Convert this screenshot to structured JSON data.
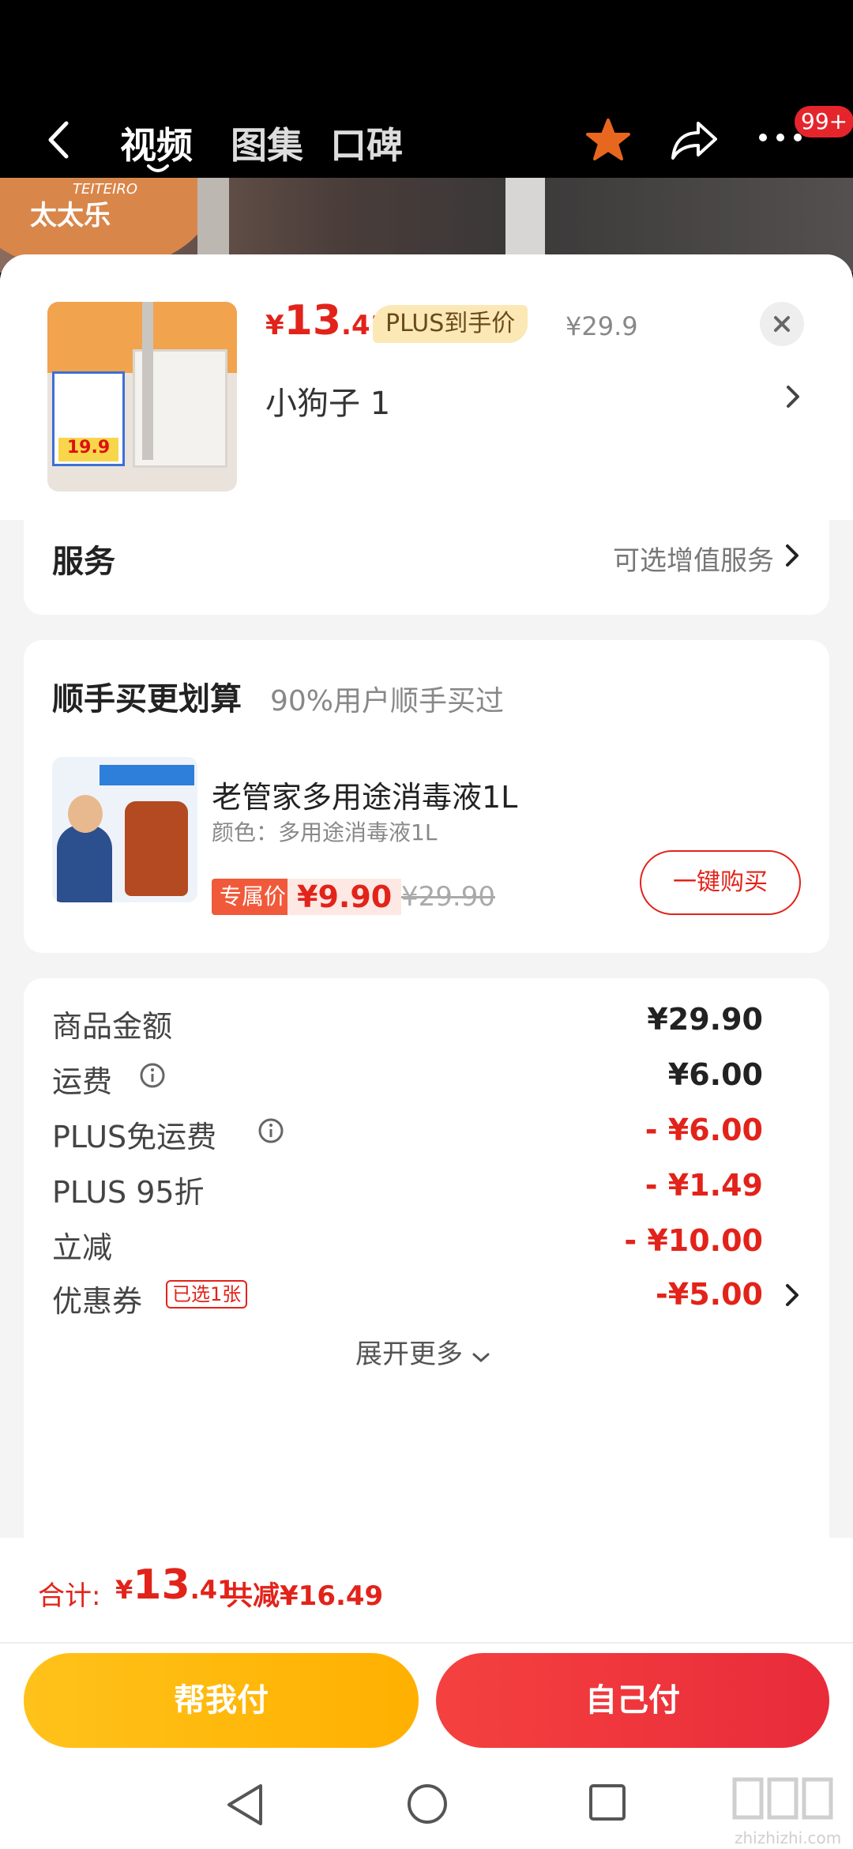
{
  "header": {
    "tabs": [
      {
        "label": "视频",
        "active": true
      },
      {
        "label": "图集",
        "active": false
      },
      {
        "label": "口碑",
        "active": false
      }
    ],
    "badge": "99+",
    "bg_brand": "TEITEIRO",
    "bg_brand_cn": "太太乐"
  },
  "product": {
    "price_currency": "¥",
    "price_int": "13",
    "price_dec": ".41",
    "plus_tag": "PLUS到手价",
    "orig_price": "¥29.9",
    "spec": "小狗子  1",
    "thumb_price": "19.9"
  },
  "service": {
    "title": "服务",
    "right": "可选增值服务"
  },
  "addon": {
    "title": "顺手买更划算",
    "subtitle": "90%用户顺手买过",
    "name": "老管家多用途消毒液1L",
    "color": "颜色：多用途消毒液1L",
    "exclusive_label": "专属价",
    "exclusive_price": "¥9.90",
    "orig_price": "¥29.90",
    "buy_label": "一键购买"
  },
  "summary": {
    "rows": [
      {
        "label": "商品金额",
        "value": "¥29.90"
      },
      {
        "label": "运费",
        "value": "¥6.00"
      },
      {
        "label": "PLUS免运费",
        "value": "- ¥6.00"
      },
      {
        "label": "PLUS 95折",
        "value": "- ¥1.49"
      },
      {
        "label": "立减",
        "value": "- ¥10.00"
      },
      {
        "label": "优惠券",
        "value": "-¥5.00"
      }
    ],
    "coupon_tag": "已选1张",
    "expand": "展开更多"
  },
  "footer": {
    "total_label": "合计:",
    "total_currency": "¥",
    "total_int": "13",
    "total_dec": ".41",
    "saved": "共减¥16.49",
    "help_pay": "帮我付",
    "self_pay": "自己付"
  },
  "watermark": {
    "text": "zhizhizhi.com"
  },
  "colors": {
    "accent_red": "#e2231a",
    "accent_yellow": "#ffb000",
    "star": "#e8671e"
  }
}
